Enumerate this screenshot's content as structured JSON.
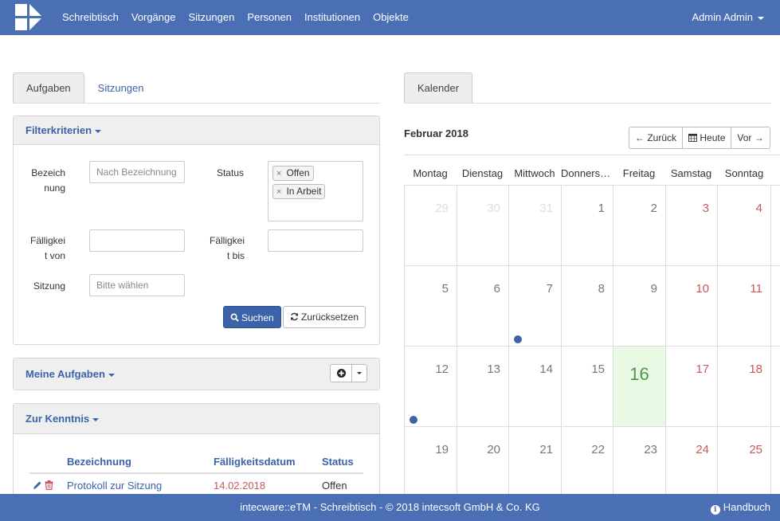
{
  "nav": {
    "items": [
      "Schreibtisch",
      "Vorgänge",
      "Sitzungen",
      "Personen",
      "Institutionen",
      "Objekte"
    ],
    "user": "Admin Admin"
  },
  "left_tabs": [
    "Aufgaben",
    "Sitzungen"
  ],
  "filter": {
    "title": "Filterkriterien",
    "bezeichnung_label_1": "Bezeich",
    "bezeichnung_label_2": "nung",
    "bezeichnung_placeholder": "Nach Bezeichnung",
    "status_label": "Status",
    "status_tags": [
      "Offen",
      "In Arbeit"
    ],
    "tag_remove": "×",
    "faellig_von_1": "Fälligkei",
    "faellig_von_2": "t von",
    "faellig_bis_1": "Fälligkei",
    "faellig_bis_2": "t bis",
    "sitzung_label": "Sitzung",
    "sitzung_placeholder": "Bitte wählen",
    "search_button": "Suchen",
    "reset_button": "Zurücksetzen"
  },
  "meine_aufgaben": {
    "title": "Meine Aufgaben"
  },
  "zur_kenntnis": {
    "title": "Zur Kenntnis",
    "columns": [
      "Bezeichnung",
      "Fälligkeitsdatum",
      "Status"
    ],
    "rows": [
      {
        "bezeichnung": "Protokoll zur Sitzung",
        "datum": "14.02.2018",
        "status": "Offen"
      }
    ]
  },
  "calendar": {
    "tab": "Kalender",
    "month_title": "Februar 2018",
    "prev": "Zurück",
    "today": "Heute",
    "next": "Vor",
    "weekdays": [
      "Montag",
      "Dienstag",
      "Mittwoch",
      "Donnerstag",
      "Freitag",
      "Samstag",
      "Sonntag"
    ],
    "weeks": [
      [
        "29",
        "30",
        "31",
        "1",
        "2",
        "3",
        "4"
      ],
      [
        "5",
        "6",
        "7",
        "8",
        "9",
        "10",
        "11"
      ],
      [
        "12",
        "13",
        "14",
        "15",
        "16",
        "17",
        "18"
      ],
      [
        "19",
        "20",
        "21",
        "22",
        "23",
        "24",
        "25"
      ]
    ],
    "today_date": "16",
    "accent": "#3a63a8",
    "weekend_color": "#c9585a",
    "today_bg": "#e8f9e4"
  },
  "footer": {
    "text": "intecware::eTM - Schreibtisch - © 2018 intecsoft GmbH & Co. KG",
    "help": "Handbuch"
  }
}
